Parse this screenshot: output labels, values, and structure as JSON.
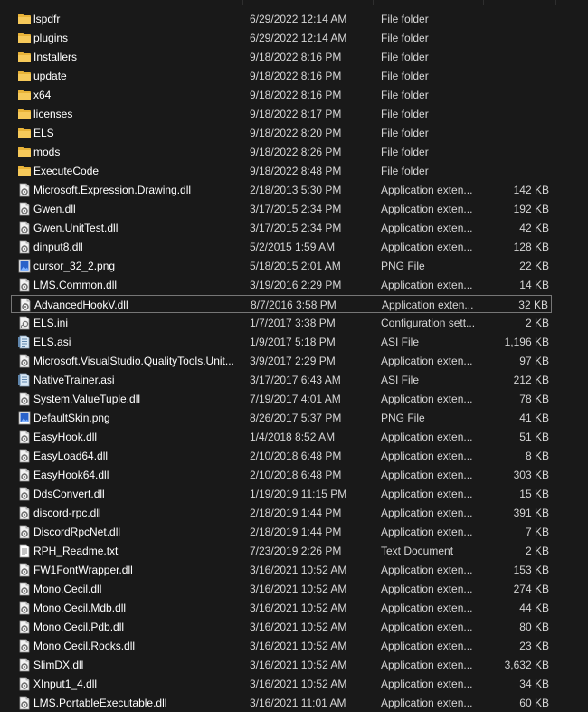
{
  "files": [
    {
      "name": "lspdfr",
      "date": "6/29/2022 12:14 AM",
      "type": "File folder",
      "size": "",
      "icon": "folder-icon"
    },
    {
      "name": "plugins",
      "date": "6/29/2022 12:14 AM",
      "type": "File folder",
      "size": "",
      "icon": "folder-icon"
    },
    {
      "name": "Installers",
      "date": "9/18/2022 8:16 PM",
      "type": "File folder",
      "size": "",
      "icon": "folder-icon"
    },
    {
      "name": "update",
      "date": "9/18/2022 8:16 PM",
      "type": "File folder",
      "size": "",
      "icon": "folder-icon"
    },
    {
      "name": "x64",
      "date": "9/18/2022 8:16 PM",
      "type": "File folder",
      "size": "",
      "icon": "folder-icon"
    },
    {
      "name": "licenses",
      "date": "9/18/2022 8:17 PM",
      "type": "File folder",
      "size": "",
      "icon": "folder-icon"
    },
    {
      "name": "ELS",
      "date": "9/18/2022 8:20 PM",
      "type": "File folder",
      "size": "",
      "icon": "folder-icon"
    },
    {
      "name": "mods",
      "date": "9/18/2022 8:26 PM",
      "type": "File folder",
      "size": "",
      "icon": "folder-icon"
    },
    {
      "name": "ExecuteCode",
      "date": "9/18/2022 8:48 PM",
      "type": "File folder",
      "size": "",
      "icon": "folder-icon"
    },
    {
      "name": "Microsoft.Expression.Drawing.dll",
      "date": "2/18/2013 5:30 PM",
      "type": "Application exten...",
      "size": "142 KB",
      "icon": "dll-icon"
    },
    {
      "name": "Gwen.dll",
      "date": "3/17/2015 2:34 PM",
      "type": "Application exten...",
      "size": "192 KB",
      "icon": "dll-icon"
    },
    {
      "name": "Gwen.UnitTest.dll",
      "date": "3/17/2015 2:34 PM",
      "type": "Application exten...",
      "size": "42 KB",
      "icon": "dll-icon"
    },
    {
      "name": "dinput8.dll",
      "date": "5/2/2015 1:59 AM",
      "type": "Application exten...",
      "size": "128 KB",
      "icon": "dll-icon"
    },
    {
      "name": "cursor_32_2.png",
      "date": "5/18/2015 2:01 AM",
      "type": "PNG File",
      "size": "22 KB",
      "icon": "png-icon"
    },
    {
      "name": "LMS.Common.dll",
      "date": "3/19/2016 2:29 PM",
      "type": "Application exten...",
      "size": "14 KB",
      "icon": "dll-icon"
    },
    {
      "name": "AdvancedHookV.dll",
      "date": "8/7/2016 3:58 PM",
      "type": "Application exten...",
      "size": "32 KB",
      "icon": "dll-icon",
      "selected": true
    },
    {
      "name": "ELS.ini",
      "date": "1/7/2017 3:38 PM",
      "type": "Configuration sett...",
      "size": "2 KB",
      "icon": "ini-icon"
    },
    {
      "name": "ELS.asi",
      "date": "1/9/2017 5:18 PM",
      "type": "ASI File",
      "size": "1,196 KB",
      "icon": "asi-icon"
    },
    {
      "name": "Microsoft.VisualStudio.QualityTools.Unit...",
      "date": "3/9/2017 2:29 PM",
      "type": "Application exten...",
      "size": "97 KB",
      "icon": "dll-icon"
    },
    {
      "name": "NativeTrainer.asi",
      "date": "3/17/2017 6:43 AM",
      "type": "ASI File",
      "size": "212 KB",
      "icon": "asi-icon"
    },
    {
      "name": "System.ValueTuple.dll",
      "date": "7/19/2017 4:01 AM",
      "type": "Application exten...",
      "size": "78 KB",
      "icon": "dll-icon"
    },
    {
      "name": "DefaultSkin.png",
      "date": "8/26/2017 5:37 PM",
      "type": "PNG File",
      "size": "41 KB",
      "icon": "png-icon"
    },
    {
      "name": "EasyHook.dll",
      "date": "1/4/2018 8:52 AM",
      "type": "Application exten...",
      "size": "51 KB",
      "icon": "dll-icon"
    },
    {
      "name": "EasyLoad64.dll",
      "date": "2/10/2018 6:48 PM",
      "type": "Application exten...",
      "size": "8 KB",
      "icon": "dll-icon"
    },
    {
      "name": "EasyHook64.dll",
      "date": "2/10/2018 6:48 PM",
      "type": "Application exten...",
      "size": "303 KB",
      "icon": "dll-icon"
    },
    {
      "name": "DdsConvert.dll",
      "date": "1/19/2019 11:15 PM",
      "type": "Application exten...",
      "size": "15 KB",
      "icon": "dll-icon"
    },
    {
      "name": "discord-rpc.dll",
      "date": "2/18/2019 1:44 PM",
      "type": "Application exten...",
      "size": "391 KB",
      "icon": "dll-icon"
    },
    {
      "name": "DiscordRpcNet.dll",
      "date": "2/18/2019 1:44 PM",
      "type": "Application exten...",
      "size": "7 KB",
      "icon": "dll-icon"
    },
    {
      "name": "RPH_Readme.txt",
      "date": "7/23/2019 2:26 PM",
      "type": "Text Document",
      "size": "2 KB",
      "icon": "txt-icon"
    },
    {
      "name": "FW1FontWrapper.dll",
      "date": "3/16/2021 10:52 AM",
      "type": "Application exten...",
      "size": "153 KB",
      "icon": "dll-icon"
    },
    {
      "name": "Mono.Cecil.dll",
      "date": "3/16/2021 10:52 AM",
      "type": "Application exten...",
      "size": "274 KB",
      "icon": "dll-icon"
    },
    {
      "name": "Mono.Cecil.Mdb.dll",
      "date": "3/16/2021 10:52 AM",
      "type": "Application exten...",
      "size": "44 KB",
      "icon": "dll-icon"
    },
    {
      "name": "Mono.Cecil.Pdb.dll",
      "date": "3/16/2021 10:52 AM",
      "type": "Application exten...",
      "size": "80 KB",
      "icon": "dll-icon"
    },
    {
      "name": "Mono.Cecil.Rocks.dll",
      "date": "3/16/2021 10:52 AM",
      "type": "Application exten...",
      "size": "23 KB",
      "icon": "dll-icon"
    },
    {
      "name": "SlimDX.dll",
      "date": "3/16/2021 10:52 AM",
      "type": "Application exten...",
      "size": "3,632 KB",
      "icon": "dll-icon"
    },
    {
      "name": "XInput1_4.dll",
      "date": "3/16/2021 10:52 AM",
      "type": "Application exten...",
      "size": "34 KB",
      "icon": "dll-icon"
    },
    {
      "name": "LMS.PortableExecutable.dll",
      "date": "3/16/2021 11:01 AM",
      "type": "Application exten...",
      "size": "60 KB",
      "icon": "dll-icon"
    }
  ]
}
